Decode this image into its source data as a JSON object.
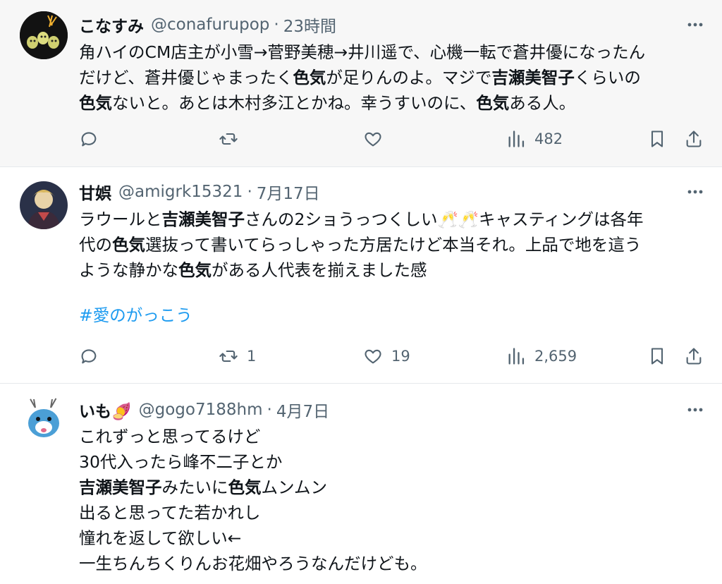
{
  "colors": {
    "text": "#0f1419",
    "muted": "#536471",
    "link": "#1d9bf0",
    "highlight_bg": "#f7f7f7"
  },
  "tweets": [
    {
      "name": "こなすみ",
      "handle": "@conafurupop",
      "dot": "·",
      "time": "23時間",
      "lines": [
        [
          {
            "t": "角ハイのCM店主が小雪→菅野美穂→井川遥で、心機一転で蒼井優になったん"
          }
        ],
        [
          {
            "t": "だけど、蒼井優じゃまったく"
          },
          {
            "t": "色気",
            "b": true
          },
          {
            "t": "が足りんのよ。マジで"
          },
          {
            "t": "吉瀬美智子",
            "b": true
          },
          {
            "t": "くらいの"
          }
        ],
        [
          {
            "t": "色気",
            "b": true
          },
          {
            "t": "ないと。あとは木村多江とかね。幸うすいのに、"
          },
          {
            "t": "色気",
            "b": true
          },
          {
            "t": "ある人。"
          }
        ]
      ],
      "actions": {
        "reply": "",
        "retweet": "",
        "like": "",
        "views": "482"
      }
    },
    {
      "name": "甘娯",
      "handle": "@amigrk15321",
      "dot": "·",
      "time": "7月17日",
      "lines": [
        [
          {
            "t": "ラウールと"
          },
          {
            "t": "吉瀬美智子",
            "b": true
          },
          {
            "t": "さんの2ショうっつくしい🥂🥂キャスティングは各年"
          }
        ],
        [
          {
            "t": "代の"
          },
          {
            "t": "色気",
            "b": true
          },
          {
            "t": "選抜って書いてらっしゃった方居たけど本当それ。上品で地を這う"
          }
        ],
        [
          {
            "t": "ような静かな"
          },
          {
            "t": "色気",
            "b": true
          },
          {
            "t": "がある人代表を揃えました感"
          }
        ]
      ],
      "hashtag": "#愛のがっこう",
      "actions": {
        "reply": "",
        "retweet": "1",
        "like": "19",
        "views": "2,659"
      }
    },
    {
      "name": "いも🍠",
      "handle": "@gogo7188hm",
      "dot": "·",
      "time": "4月7日",
      "lines": [
        [
          {
            "t": "これずっと思ってるけど"
          }
        ],
        [
          {
            "t": "30代入ったら峰不二子とか"
          }
        ],
        [
          {
            "t": "吉瀬美智子",
            "b": true
          },
          {
            "t": "みたいに"
          },
          {
            "t": "色気",
            "b": true
          },
          {
            "t": "ムンムン"
          }
        ],
        [
          {
            "t": "出ると思ってた若かれし"
          }
        ],
        [
          {
            "t": "憧れを返して欲しい←"
          }
        ],
        [
          {
            "t": "一生ちんちくりんお花畑やろうなんだけども。"
          }
        ]
      ]
    }
  ]
}
